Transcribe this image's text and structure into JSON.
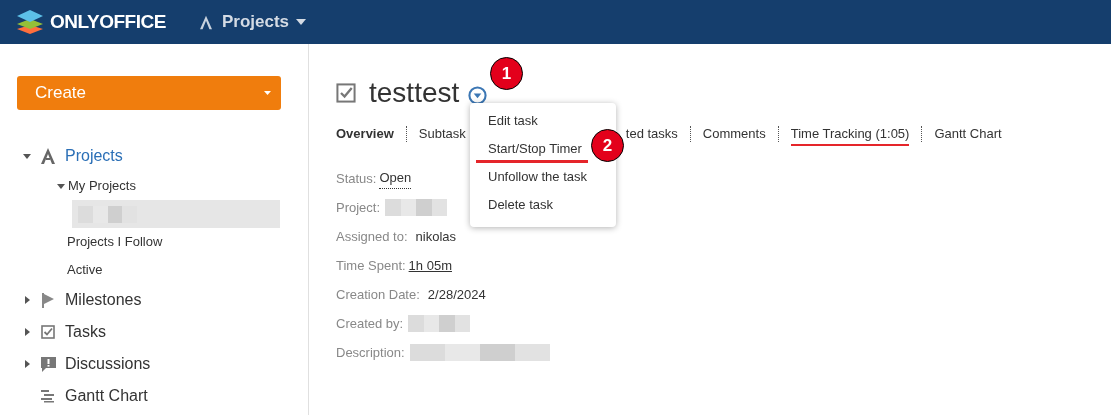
{
  "header": {
    "logo": "ONLYOFFICE",
    "module": "Projects"
  },
  "create_button": "Create",
  "sidebar": {
    "items": [
      {
        "label": "Projects",
        "kind": "projects",
        "expanded": true,
        "selected": true,
        "children": [
          {
            "label": "My Projects",
            "expanded": true,
            "children": [
              {
                "blurred": true,
                "selected": true
              }
            ]
          },
          {
            "label": "Projects I Follow"
          },
          {
            "label": "Active"
          }
        ]
      },
      {
        "label": "Milestones",
        "kind": "milestones",
        "expanded": false,
        "selected": false
      },
      {
        "label": "Tasks",
        "kind": "tasks",
        "expanded": false,
        "selected": false
      },
      {
        "label": "Discussions",
        "kind": "discussions",
        "expanded": false,
        "selected": false
      },
      {
        "label": "Gantt Chart",
        "kind": "gantt",
        "selected": false
      }
    ]
  },
  "task": {
    "title": "testtest"
  },
  "tabs": [
    {
      "label": "Overview",
      "selected": true,
      "underlined": false
    },
    {
      "label": "Subtask",
      "selected": false,
      "underlined": false
    },
    {
      "label": "ted tasks",
      "selected": false,
      "underlined": false
    },
    {
      "label": "Comments",
      "selected": false,
      "underlined": false
    },
    {
      "label": "Time Tracking (1:05)",
      "selected": false,
      "underlined": true
    },
    {
      "label": "Gantt Chart",
      "selected": false,
      "underlined": false
    }
  ],
  "fields": [
    {
      "label": "Status:",
      "value": "Open",
      "kind": "dotted"
    },
    {
      "label": "Project:",
      "kind": "blurred"
    },
    {
      "label": "Assigned to:",
      "value": "nikolas",
      "kind": "plain"
    },
    {
      "label": "Time Spent:",
      "value": "1h 05m",
      "kind": "link"
    },
    {
      "label": "Creation Date:",
      "value": "2/28/2024",
      "kind": "plain"
    },
    {
      "label": "Created by:",
      "kind": "blurred"
    },
    {
      "label": "Description:",
      "kind": "blurred"
    }
  ],
  "menu": {
    "items": [
      {
        "label": "Edit task",
        "underlined": false
      },
      {
        "label": "Start/Stop Timer",
        "underlined": true
      },
      {
        "label": "Unfollow the task",
        "underlined": false
      },
      {
        "label": "Delete task",
        "underlined": false
      }
    ]
  },
  "annotations": [
    {
      "label": "1"
    },
    {
      "label": "2"
    }
  ]
}
